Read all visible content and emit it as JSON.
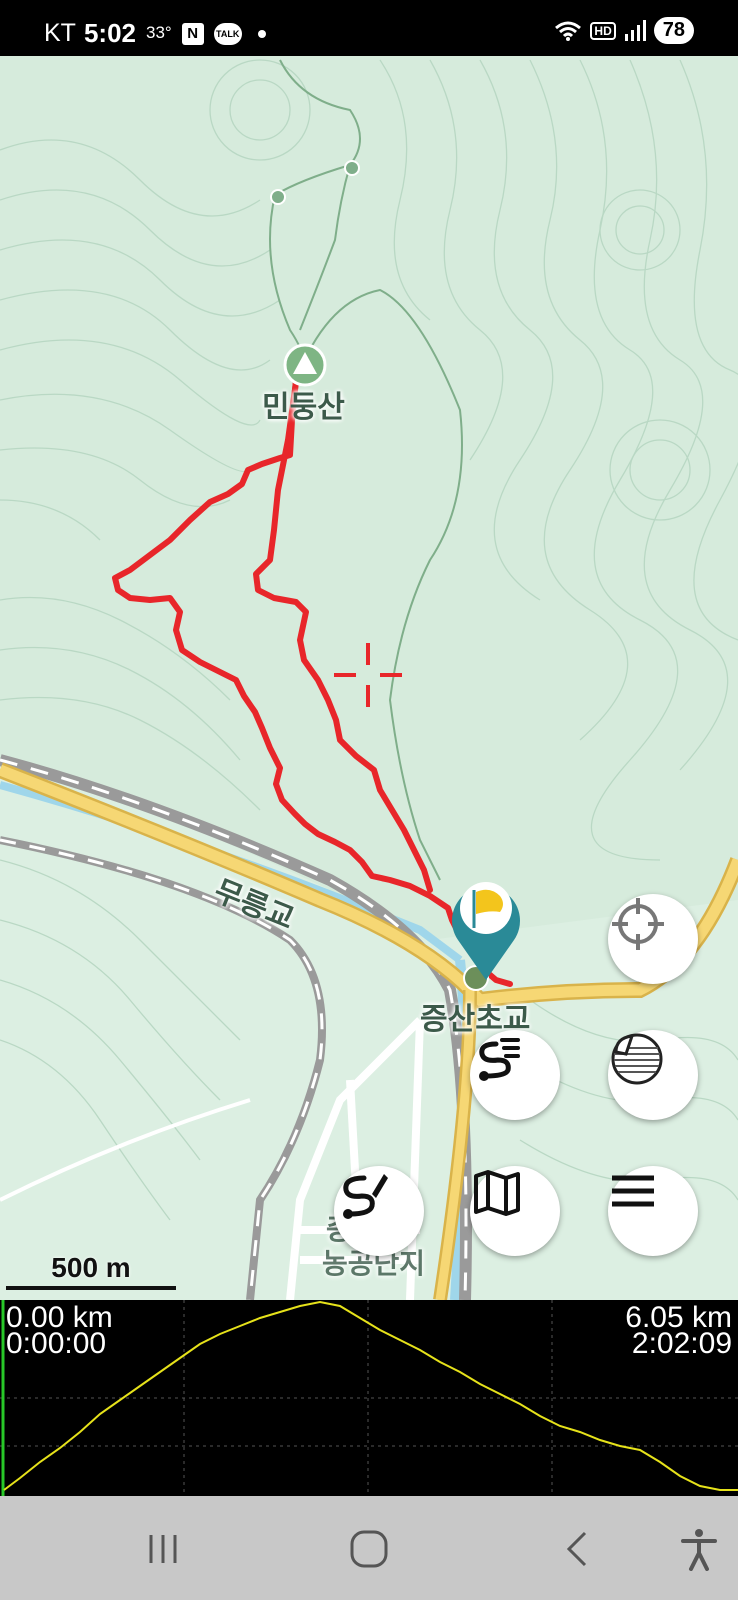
{
  "status_bar": {
    "carrier": "KT",
    "time": "5:02",
    "temperature": "33°",
    "naver_icon": "N",
    "talk_icon": "TALK",
    "hd_label": "HD",
    "battery": "78"
  },
  "map": {
    "peak_label": "민둥산",
    "bridge_label": "무릉교",
    "school_label": "증산초교",
    "complex_label_line1": "증산",
    "complex_label_line2": "농공단지",
    "scale_label": "500 m",
    "colors": {
      "track": "#e8262a",
      "pin": "#2a8a97",
      "land": "#d6ebdc",
      "road": "#f6d774"
    }
  },
  "buttons": {
    "locate": "crosshair-icon",
    "layers": "layers-icon",
    "route_list": "route-list-icon",
    "draw_route": "draw-route-icon",
    "map": "map-icon",
    "menu": "menu-icon"
  },
  "elevation": {
    "start_distance": "0.00 km",
    "start_time": "0:00:00",
    "end_distance": "6.05 km",
    "end_time": "2:02:09",
    "line_color": "#e6e21a"
  },
  "navbar": {
    "recent": "recent-apps-icon",
    "home": "home-icon",
    "back": "back-icon",
    "accessibility": "accessibility-icon"
  }
}
